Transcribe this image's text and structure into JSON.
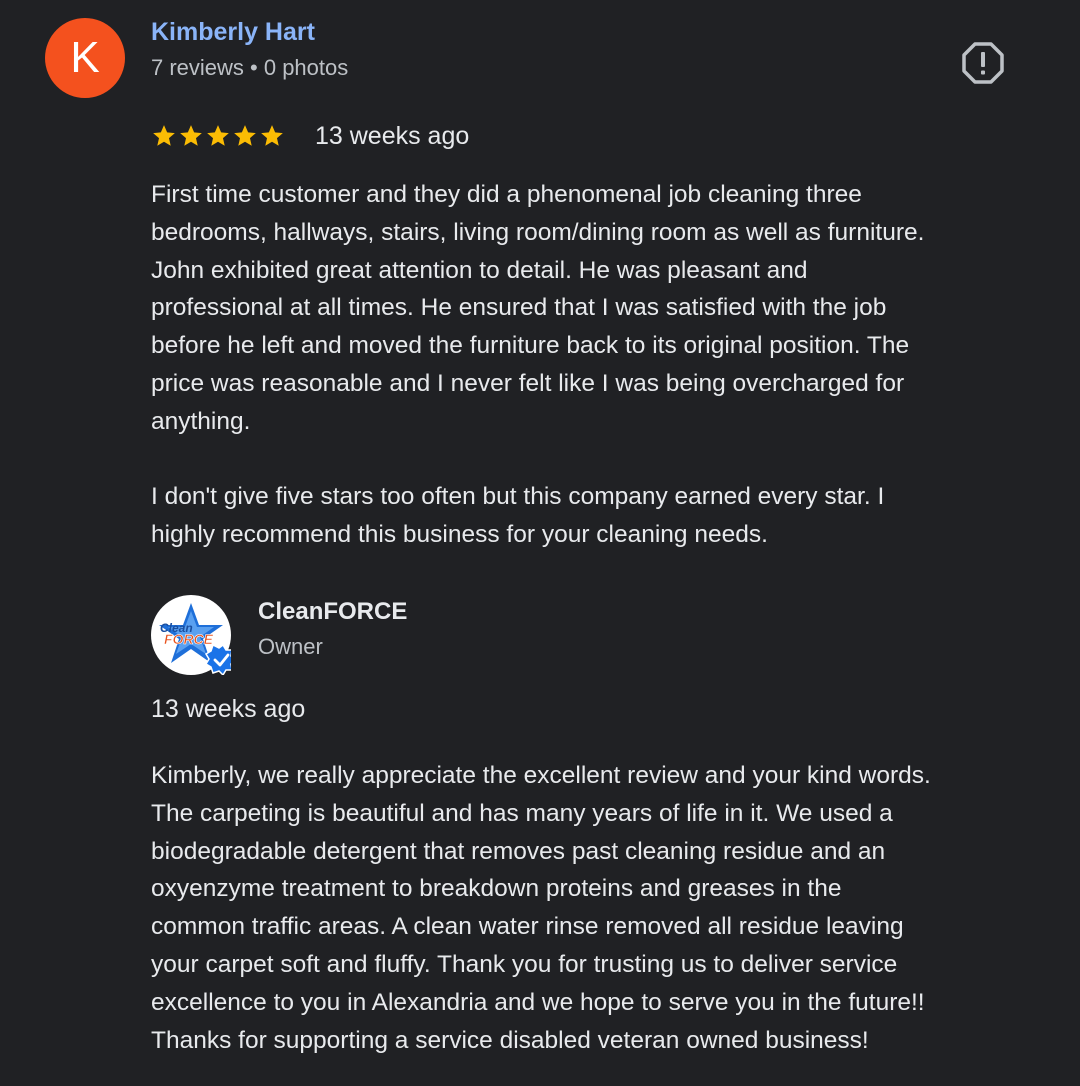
{
  "review": {
    "avatar_letter": "K",
    "avatar_color": "#f4511e",
    "name": "Kimberly Hart",
    "name_color": "#8ab4f8",
    "meta": "7 reviews • 0 photos",
    "report_icon": "report-flag-icon",
    "rating": 5,
    "rating_max": 5,
    "star_color": "#fbbc04",
    "date": "13 weeks ago",
    "text_lines": [
      "First time customer and they did a phenomenal job cleaning three",
      "bedrooms, hallways, stairs, living room/dining room as well as furniture.",
      "John exhibited great attention to detail. He was pleasant and",
      "professional at all times. He ensured that I was satisfied with the job",
      "before he left and moved the furniture back to its original position. The",
      "price was reasonable and I never felt like I was being overcharged for",
      "anything.",
      "",
      "I don't give five stars too often but this company earned every star. I",
      "highly recommend this business for your cleaning needs."
    ]
  },
  "owner_response": {
    "logo_text_top": "Clean",
    "logo_text_bottom": "FORCE",
    "verified_icon": "verified-badge-icon",
    "verified_color": "#1a73e8",
    "name": "CleanFORCE",
    "role": "Owner",
    "date": "13 weeks ago",
    "text_lines": [
      "Kimberly, we really appreciate the excellent review and your kind words.",
      "The carpeting is beautiful and has many years of life in it. We used a",
      "biodegradable detergent that removes past cleaning residue and an",
      "oxyenzyme treatment to breakdown proteins and greases in the",
      "common traffic areas. A clean water rinse removed all residue leaving",
      "your carpet soft and fluffy. Thank you for trusting us to deliver service",
      "excellence to you in Alexandria and we hope to serve you in the future!!",
      "Thanks for supporting a service disabled veteran owned business!"
    ]
  }
}
